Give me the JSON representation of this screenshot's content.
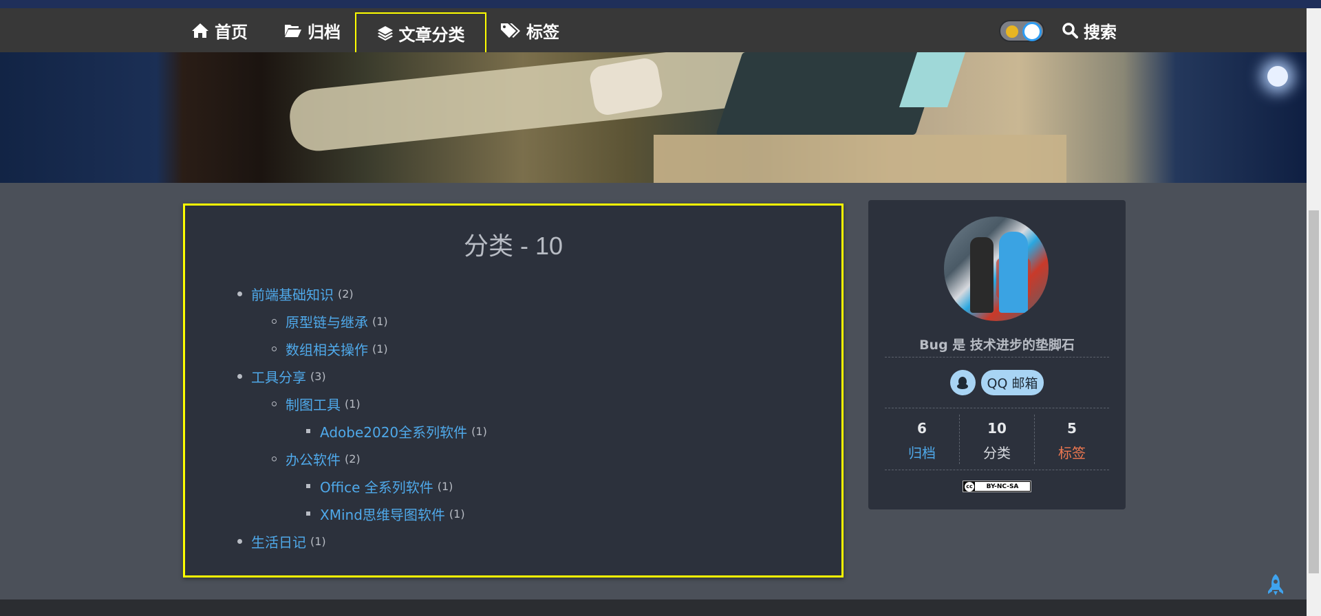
{
  "nav": {
    "home": "首页",
    "archive": "归档",
    "categories": "文章分类",
    "tags": "标签",
    "search": "搜索"
  },
  "main": {
    "title": "分类 - 10",
    "categories": [
      {
        "label": "前端基础知识",
        "count": "(2)",
        "level": 1
      },
      {
        "label": "原型链与继承",
        "count": "(1)",
        "level": 2
      },
      {
        "label": "数组相关操作",
        "count": "(1)",
        "level": 2
      },
      {
        "label": "工具分享",
        "count": "(3)",
        "level": 1
      },
      {
        "label": "制图工具",
        "count": "(1)",
        "level": 2
      },
      {
        "label": "Adobe2020全系列软件",
        "count": "(1)",
        "level": 3
      },
      {
        "label": "办公软件",
        "count": "(2)",
        "level": 2
      },
      {
        "label": "Office 全系列软件",
        "count": "(1)",
        "level": 3
      },
      {
        "label": "XMind思维导图软件",
        "count": "(1)",
        "level": 3
      },
      {
        "label": "生活日记",
        "count": "(1)",
        "level": 1
      }
    ]
  },
  "sidebar": {
    "motto": "Bug 是 技术进步的垫脚石",
    "qq_mail": "QQ 邮箱",
    "stats": {
      "archive_num": "6",
      "archive_label": "归档",
      "cat_num": "10",
      "cat_label": "分类",
      "tags_num": "5",
      "tags_label": "标签"
    },
    "license": "BY-NC-SA",
    "license_cc": "cc"
  },
  "colors": {
    "highlight": "#ffff00",
    "link": "#4fa9ea",
    "tags": "#f07850"
  },
  "icons": [
    "home-icon",
    "folder-open-icon",
    "layers-icon",
    "tags-icon",
    "search-icon",
    "theme-toggle",
    "qq-penguin-icon",
    "rocket-icon"
  ]
}
